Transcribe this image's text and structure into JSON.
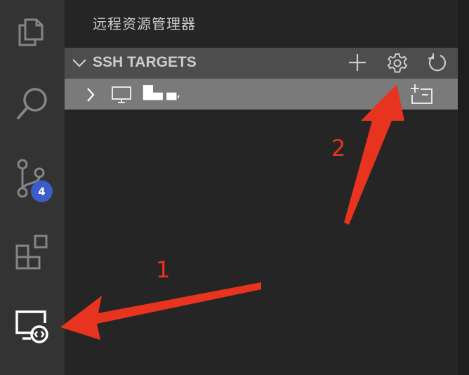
{
  "sidebar": {
    "title": "远程资源管理器",
    "section": {
      "title": "SSH TARGETS",
      "expanded": true
    },
    "tree": [
      {
        "label": "█▄ ▄,",
        "icon": "monitor-icon",
        "collapsed": true
      }
    ]
  },
  "activity_bar": {
    "items": [
      {
        "icon": "explorer-icon"
      },
      {
        "icon": "search-icon"
      },
      {
        "icon": "source-control-icon",
        "badge": "4"
      },
      {
        "icon": "extensions-icon"
      },
      {
        "icon": "remote-explorer-icon",
        "active": true
      }
    ]
  },
  "annotations": {
    "label_1": "1",
    "label_2": "2",
    "color": "#e8331f"
  }
}
